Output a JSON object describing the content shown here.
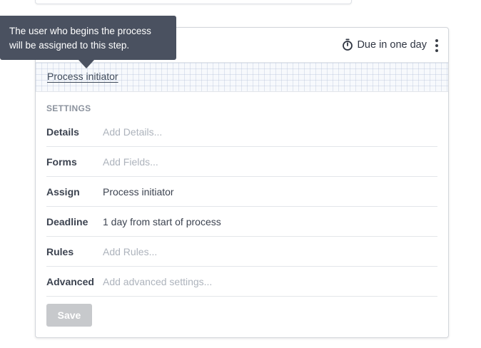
{
  "tooltip": {
    "line1": "The user who begins the process",
    "line2": "will be assigned to this step."
  },
  "step": {
    "due_label": "Due in one day",
    "assignee": "Process initiator"
  },
  "settings": {
    "heading": "SETTINGS",
    "rows": [
      {
        "label": "Details",
        "value": "Add Details...",
        "placeholder": true
      },
      {
        "label": "Forms",
        "value": "Add Fields...",
        "placeholder": true
      },
      {
        "label": "Assign",
        "value": "Process initiator",
        "placeholder": false
      },
      {
        "label": "Deadline",
        "value": "1 day from start of process",
        "placeholder": false
      },
      {
        "label": "Rules",
        "value": "Add Rules...",
        "placeholder": true
      },
      {
        "label": "Advanced",
        "value": "Add advanced settings...",
        "placeholder": true
      }
    ]
  },
  "actions": {
    "save_label": "Save"
  },
  "icons": {
    "timer": "stopwatch-icon",
    "menu": "vertical-ellipsis-icon"
  },
  "colors": {
    "tooltip_bg": "#4a5160",
    "save_disabled_bg": "#c7c9cc"
  }
}
